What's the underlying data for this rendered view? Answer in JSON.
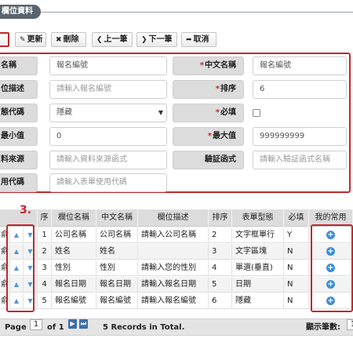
{
  "page_title": "欄位資料",
  "toolbar": {
    "edit": "更新",
    "delete": "刪除",
    "prev": "上一筆",
    "next": "下一筆",
    "cancel": "取消"
  },
  "form": {
    "name_label": "名稱",
    "name_value": "報名編號",
    "cname_label": "中文名稱",
    "cname_value": "報名編號",
    "desc_label": "位描述",
    "desc_placeholder": "請輸入報名編號",
    "order_label": "排序",
    "order_value": "6",
    "type_label": "態代碼",
    "type_value": "隱藏",
    "required_label": "必填",
    "min_label": "最小值",
    "min_value": "0",
    "max_label": "最大值",
    "max_value": "999999999",
    "source_label": "料來源",
    "source_placeholder": "請輸入資料來源函式",
    "validate_label": "驗証函式",
    "validate_placeholder": "請輸入驗証函式名稱",
    "code_label": "用代碼",
    "code_placeholder": "請輸入表單使用代碼"
  },
  "callout_number": "3.",
  "grid": {
    "columns": [
      "序",
      "欄位名稱",
      "中文名稱",
      "欄位描述",
      "排序",
      "表單型態",
      "必填",
      "我的常用"
    ],
    "rows": [
      {
        "seq": "1",
        "name": "公司名稱",
        "cname": "公司名稱",
        "desc": "請輸入公司名稱",
        "order": "2",
        "type": "文字框單行",
        "req": "Y"
      },
      {
        "seq": "2",
        "name": "姓名",
        "cname": "姓名",
        "desc": "",
        "order": "3",
        "type": "文字區塊",
        "req": "N"
      },
      {
        "seq": "3",
        "name": "性別",
        "cname": "性別",
        "desc": "請輸入您的性別",
        "order": "4",
        "type": "單選(垂直)",
        "req": "N"
      },
      {
        "seq": "4",
        "name": "報名日期",
        "cname": "報名日期",
        "desc": "請輸入報名日期",
        "order": "5",
        "type": "日期",
        "req": "N"
      },
      {
        "seq": "5",
        "name": "報名編號",
        "cname": "報名編號",
        "desc": "請輸入報名編號",
        "order": "6",
        "type": "隱藏",
        "req": "N"
      }
    ],
    "row_prefix": "俞"
  },
  "pager": {
    "page_label": "Page",
    "page_value": "1",
    "of_label": "of 1",
    "records_text": "5 Records in Total.",
    "display_label": "顯示筆數:",
    "display_value": "1"
  },
  "icons": {
    "edit": "pencil-icon",
    "delete": "x-icon",
    "prev": "chevron-left-icon",
    "next": "chevron-right-icon",
    "cancel": "undo-arrow-icon",
    "move_up": "arrow-up-icon",
    "move_down": "arrow-down-icon",
    "favorite": "plus-circle-icon"
  },
  "colors": {
    "highlight": "#c0282e",
    "title_bg": "#59646d",
    "plus_icon": "#3b8fd6"
  }
}
